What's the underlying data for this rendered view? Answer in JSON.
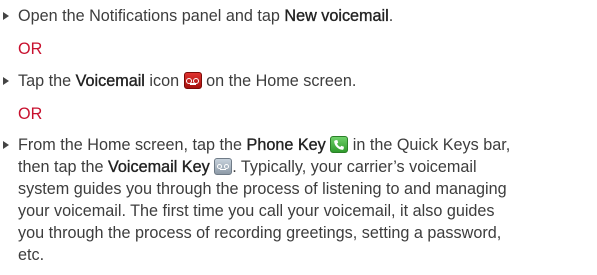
{
  "steps": [
    {
      "parts": [
        "Open the Notifications panel and tap ",
        "New voicemail",
        "."
      ]
    },
    {
      "parts": [
        "Tap the ",
        "Voicemail",
        " icon ",
        " on the Home screen."
      ],
      "icon": "voicemail-app-icon"
    },
    {
      "lines": [
        [
          "From the Home screen, tap the ",
          "Phone Key",
          " in the Quick Keys bar,"
        ],
        [
          "then tap the ",
          "Voicemail Key",
          ". Typically, your carrier’s voicemail"
        ],
        [
          "system guides you through the process of listening to and managing"
        ],
        [
          "your voicemail. The first time you call your voicemail, it also guides"
        ],
        [
          "you through the process of recording greetings, setting a password,"
        ],
        [
          "etc."
        ]
      ],
      "icons": [
        "phone-key-icon",
        "voicemail-key-icon"
      ]
    }
  ],
  "separators": [
    "OR",
    "OR"
  ],
  "colors": {
    "text": "#3d3d3d",
    "or_accent": "#c8102e"
  }
}
